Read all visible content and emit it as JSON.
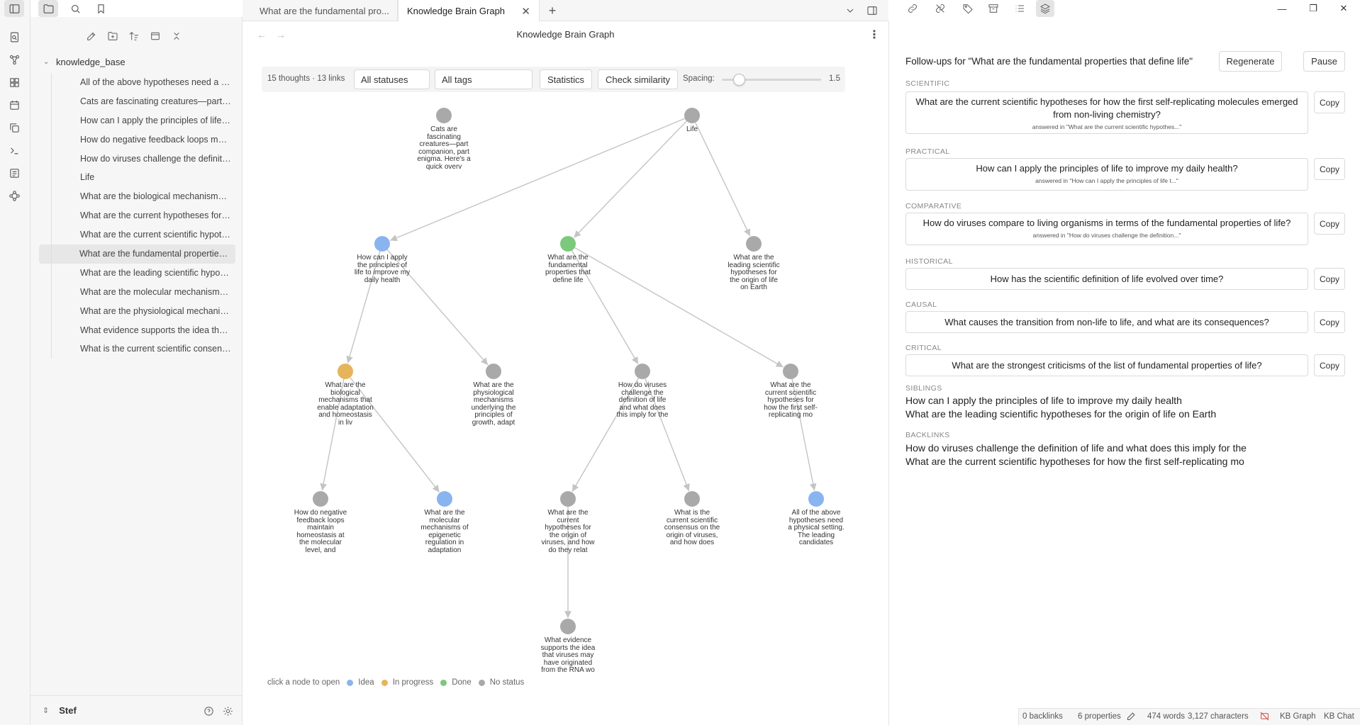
{
  "app": {
    "colors": {
      "idea": "#8ab4f0",
      "in_progress": "#e6b45c",
      "done": "#7cc87c",
      "no_status": "#a9a9a9",
      "edge": "#c4c4c4"
    },
    "ribbon_icons": [
      "open-sidebar-icon",
      "files-icon",
      "search-icon",
      "bookmark-icon",
      "file-plus-icon",
      "graph-icon",
      "dashboard-icon",
      "calendar-icon",
      "copy-icon",
      "terminal-icon",
      "list-icon",
      "network-icon"
    ]
  },
  "sidebar": {
    "actions": [
      "new-note-icon",
      "new-folder-icon",
      "sort-icon",
      "collapse-icon",
      "close-all-icon"
    ],
    "root_folder": "knowledge_base",
    "files": [
      "All of the above hypotheses need a p...",
      "Cats are fascinating creatures—part c...",
      "How can I apply the principles of life t...",
      "How do negative feedback loops mai...",
      "How do viruses challenge the definiti...",
      "Life",
      "What are the biological mechanisms t...",
      "What are the current hypotheses for t...",
      "What are the current scientific hypoth...",
      "What are the fundamental properties ...",
      "What are the leading scientific hypoth...",
      "What are the molecular mechanisms ...",
      "What are the physiological mechanis...",
      "What evidence supports the idea that...",
      "What is the current scientific consens..."
    ],
    "active_index": 9,
    "vault_name": "Stef"
  },
  "tabs": [
    {
      "label": "What are the fundamental pro...",
      "active": false
    },
    {
      "label": "Knowledge Brain Graph",
      "active": true
    }
  ],
  "tab_close": "✕",
  "tab_new": "+",
  "view": {
    "title": "Knowledge Brain Graph"
  },
  "graph_toolbar": {
    "count": "15 thoughts · 13 links",
    "status_filter": "All statuses",
    "tag_filter": "All tags",
    "statistics_label": "Statistics",
    "similarity_label": "Check similarity",
    "spacing_label": "Spacing:",
    "spacing_value": "1.5",
    "spacing_level": 0.17
  },
  "graph": {
    "nodes": [
      {
        "id": "cats",
        "status": "no_status",
        "label": "Cats are fascinating creatures—part companion, part enigma. Here's a quick overv"
      },
      {
        "id": "life",
        "status": "no_status",
        "label": "Life"
      },
      {
        "id": "apply",
        "status": "idea",
        "label": "How can I apply the principles of life to improve my daily health"
      },
      {
        "id": "fund",
        "status": "done",
        "label": "What are the fundamental properties that define life"
      },
      {
        "id": "leading",
        "status": "no_status",
        "label": "What are the leading scientific hypotheses for the origin of life on Earth"
      },
      {
        "id": "bio",
        "status": "in_progress",
        "label": "What are the biological mechanisms that enable adaptation and homeostasis in liv"
      },
      {
        "id": "physio",
        "status": "no_status",
        "label": "What are the physiological mechanisms underlying the principles of growth, adapt"
      },
      {
        "id": "viruses",
        "status": "no_status",
        "label": "How do viruses challenge the definition of life and what does this imply for the"
      },
      {
        "id": "current",
        "status": "no_status",
        "label": "What are the current scientific hypotheses for how the first self-replicating mo"
      },
      {
        "id": "negfb",
        "status": "no_status",
        "label": "How do negative feedback loops maintain homeostasis at the molecular level, and"
      },
      {
        "id": "molec",
        "status": "idea",
        "label": "What are the molecular mechanisms of epigenetic regulation in adaptation"
      },
      {
        "id": "curhyp",
        "status": "no_status",
        "label": "What are the current hypotheses for the origin of viruses, and how do they relat"
      },
      {
        "id": "consensus",
        "status": "no_status",
        "label": "What is the current scientific consensus on the origin of viruses, and how does"
      },
      {
        "id": "allabove",
        "status": "idea",
        "label": "All of the above hypotheses need a physical setting. The leading candidates"
      },
      {
        "id": "evidence",
        "status": "no_status",
        "label": "What evidence supports the idea that viruses may have originated from the RNA wo"
      }
    ],
    "links": [
      [
        "life",
        "apply"
      ],
      [
        "life",
        "fund"
      ],
      [
        "life",
        "leading"
      ],
      [
        "apply",
        "bio"
      ],
      [
        "apply",
        "physio"
      ],
      [
        "fund",
        "viruses"
      ],
      [
        "fund",
        "current"
      ],
      [
        "bio",
        "negfb"
      ],
      [
        "bio",
        "molec"
      ],
      [
        "viruses",
        "curhyp"
      ],
      [
        "viruses",
        "consensus"
      ],
      [
        "current",
        "allabove"
      ],
      [
        "curhyp",
        "evidence"
      ]
    ]
  },
  "legend": {
    "hint": "click a node to open",
    "idea": "Idea",
    "in_progress": "In progress",
    "done": "Done",
    "no_status": "No status"
  },
  "right_toolbar": {
    "icons": [
      "link-icon",
      "unlink-icon",
      "tag-icon",
      "archive-icon",
      "outline-icon",
      "layers-icon"
    ],
    "window_controls": [
      "—",
      "❐",
      "✕"
    ]
  },
  "followups": {
    "heading": "Follow-ups for \"What are the fundamental properties that define life\"",
    "regenerate_label": "Regenerate",
    "pause_label": "Pause",
    "copy_label": "Copy",
    "categories": [
      {
        "label": "SCIENTIFIC",
        "question": "What are the current scientific hypotheses for how the first self-replicating molecules emerged from non-living chemistry?",
        "answered": "answered in \"What are the current scientific hypothes...\""
      },
      {
        "label": "PRACTICAL",
        "question": "How can I apply the principles of life to improve my daily health?",
        "answered": "answered in \"How can I apply the principles of life t...\""
      },
      {
        "label": "COMPARATIVE",
        "question": "How do viruses compare to living organisms in terms of the fundamental properties of life?",
        "answered": "answered in \"How do viruses challenge the definition...\""
      },
      {
        "label": "HISTORICAL",
        "question": "How has the scientific definition of life evolved over time?",
        "answered": ""
      },
      {
        "label": "CAUSAL",
        "question": "What causes the transition from non-life to life, and what are its consequences?",
        "answered": ""
      },
      {
        "label": "CRITICAL",
        "question": "What are the strongest criticisms of the list of fundamental properties of life?",
        "answered": ""
      }
    ],
    "siblings_label": "SIBLINGS",
    "siblings": [
      "How can I apply the principles of life to improve my daily health",
      "What are the leading scientific hypotheses for the origin of life on Earth"
    ],
    "backlinks_label": "BACKLINKS",
    "backlinks": [
      "How do viruses challenge the definition of life and what does this imply for the",
      "What are the current scientific hypotheses for how the first self-replicating mo"
    ]
  },
  "statusbar": {
    "backlinks": "0 backlinks",
    "properties": "6 properties",
    "words": "474 words",
    "characters": "3,127 characters",
    "kb_graph": "KB Graph",
    "kb_chat": "KB Chat"
  }
}
